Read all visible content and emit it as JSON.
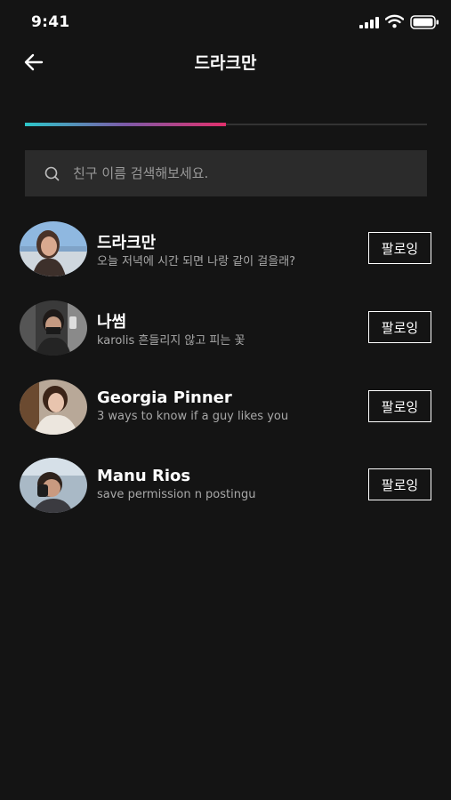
{
  "status_bar": {
    "time": "9:41",
    "icons": [
      "signal-icon",
      "wifi-icon",
      "battery-icon"
    ]
  },
  "header": {
    "title": "드라크만",
    "back_icon": "back-arrow-icon"
  },
  "tabs": {
    "indicator_colors": [
      "#2cc6c9",
      "#7d5aa8",
      "#e1306c"
    ]
  },
  "search": {
    "placeholder": "친구 이름 검색해보세요.",
    "value": ""
  },
  "friends": [
    {
      "name": "드라크만",
      "status": "오늘 저녁에 시간 되면 나랑 같이 걸을래?",
      "button": "팔로잉"
    },
    {
      "name": "나썸",
      "status": "karolis 흔들리지 않고 피는 꽃",
      "button": "팔로잉"
    },
    {
      "name": "Georgia Pinner",
      "status": "3 ways to know if a guy likes you",
      "button": "팔로잉"
    },
    {
      "name": "Manu Rios",
      "status": "save permission n postingu",
      "button": "팔로잉"
    }
  ],
  "colors": {
    "background": "#141414",
    "search_bg": "#2b2b2b",
    "text_secondary": "#a8a8a8"
  }
}
